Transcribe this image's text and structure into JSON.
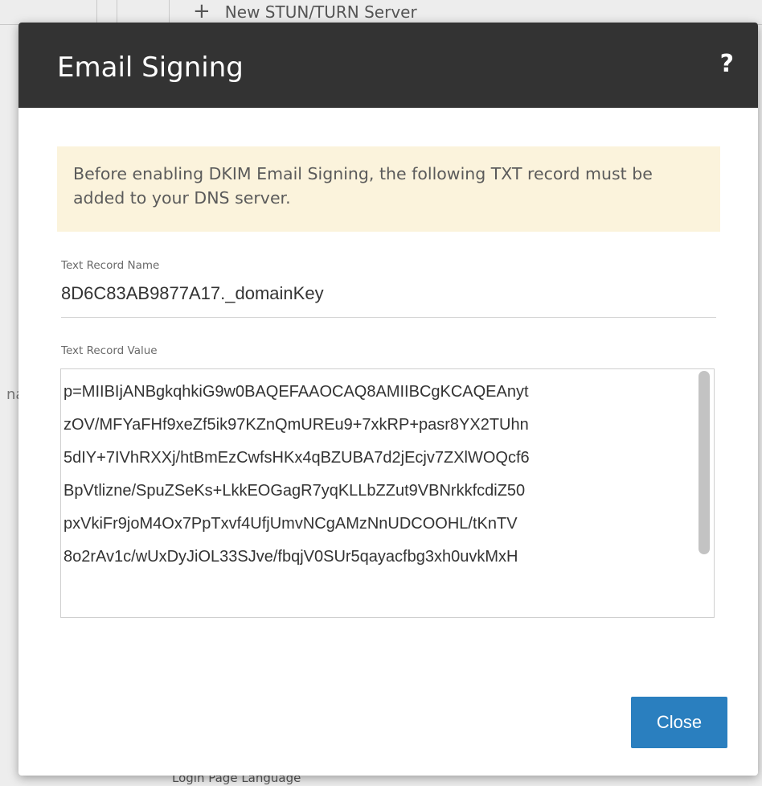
{
  "background": {
    "top_item": "New STUN/TURN Server",
    "bottom_item": "Login Page Language",
    "side_fragment": "na"
  },
  "dialog": {
    "title": "Email Signing",
    "help": "?",
    "notice": "Before enabling DKIM Email Signing, the following TXT record must be added to your DNS server.",
    "record_name_label": "Text Record Name",
    "record_name_value": "8D6C83AB9877A17._domainKey",
    "record_value_label": "Text Record Value",
    "record_value_lines": [
      "p=MIIBIjANBgkqhkiG9w0BAQEFAAOCAQ8AMIIBCgKCAQEAnyt",
      "zOV/MFYaFHf9xeZf5ik97KZnQmUREu9+7xkRP+pasr8YX2TUhn",
      "5dIY+7IVhRXXj/htBmEzCwfsHKx4qBZUBA7d2jEcjv7ZXlWOQcf6",
      "BpVtlizne/SpuZSeKs+LkkEOGagR7yqKLLbZZut9VBNrkkfcdiZ50",
      "pxVkiFr9joM4Ox7PpTxvf4UfjUmvNCgAMzNnUDCOOHL/tKnTV",
      "8o2rAv1c/wUxDyJiOL33SJve/fbqjV0SUr5qayacfbg3xh0uvkMxH"
    ],
    "close_label": "Close"
  },
  "colors": {
    "header_bg": "#333333",
    "notice_bg": "#fbf3dc",
    "button_bg": "#2a7fbf"
  }
}
